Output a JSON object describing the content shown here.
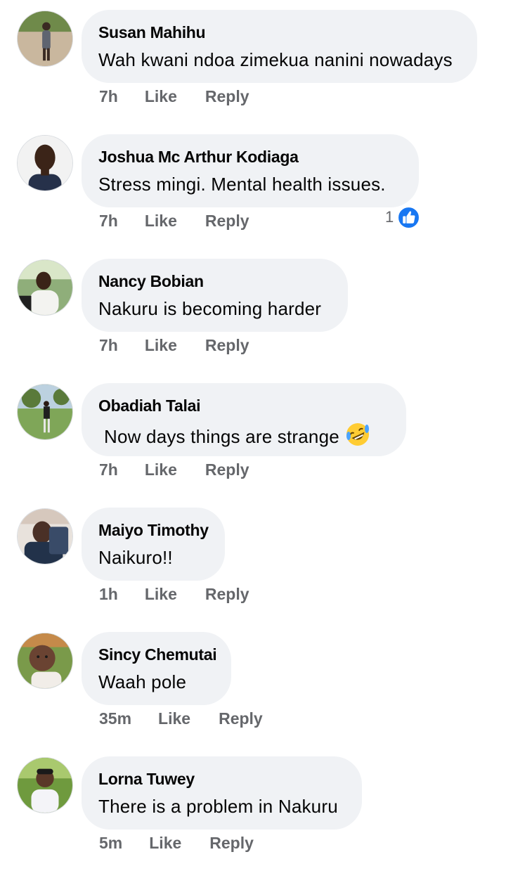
{
  "comments": [
    {
      "author": "Susan Mahihu",
      "text": "Wah kwani ndoa zimekua nanini nowadays",
      "time": "7h",
      "like": "Like",
      "reply": "Reply"
    },
    {
      "author": "Joshua Mc Arthur Kodiaga",
      "text": "Stress mingi. Mental health issues.",
      "time": "7h",
      "like": "Like",
      "reply": "Reply",
      "reaction_count": "1",
      "reaction_icon": "thumbs-up-icon",
      "reaction_color": "#1877f2"
    },
    {
      "author": "Nancy Bobian",
      "text": "Nakuru is becoming harder",
      "time": "7h",
      "like": "Like",
      "reply": "Reply"
    },
    {
      "author": "Obadiah Talai",
      "text": "Now days things are strange",
      "emoji": "rolling-on-floor-laughing-emoji",
      "time": "7h",
      "like": "Like",
      "reply": "Reply"
    },
    {
      "author": "Maiyo Timothy",
      "text": "Naikuro!!",
      "time": "1h",
      "like": "Like",
      "reply": "Reply"
    },
    {
      "author": "Sincy Chemutai",
      "text": "Waah pole",
      "time": "35m",
      "like": "Like",
      "reply": "Reply"
    },
    {
      "author": "Lorna Tuwey",
      "text": "There is a problem in Nakuru",
      "time": "5m",
      "like": "Like",
      "reply": "Reply"
    }
  ],
  "colors": {
    "bubble": "#f0f2f5",
    "meta": "#65676b",
    "like_blue": "#1877f2"
  }
}
